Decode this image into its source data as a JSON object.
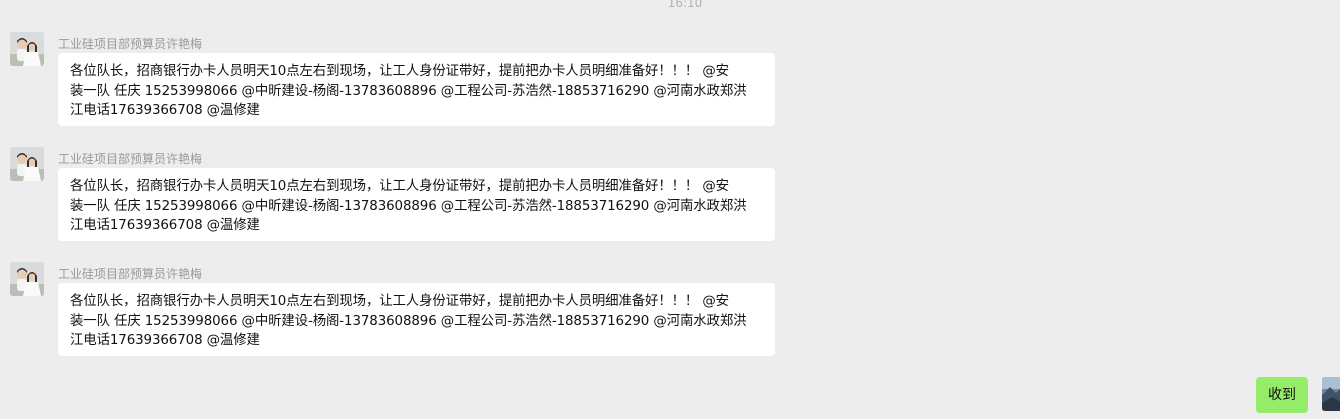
{
  "chat": {
    "timestamp": "16:10",
    "messages": [
      {
        "sender": "工业硅项目部预算员许艳梅",
        "avatar_icon": "couple-photo-avatar-icon",
        "lines": [
          "各位队长，招商银行办卡人员明天10点左右到现场，让工人身份证带好，提前把办卡人员明细准备好！！！ @安",
          "装一队 任庆 15253998066 @中昕建设-杨阁-13783608896 @工程公司-苏浩然-18853716290 @河南水政郑洪",
          "江电话17639366708 @温修建"
        ]
      },
      {
        "sender": "工业硅项目部预算员许艳梅",
        "avatar_icon": "couple-photo-avatar-icon",
        "lines": [
          "各位队长，招商银行办卡人员明天10点左右到现场，让工人身份证带好，提前把办卡人员明细准备好！！！ @安",
          "装一队 任庆 15253998066 @中昕建设-杨阁-13783608896 @工程公司-苏浩然-18853716290 @河南水政郑洪",
          "江电话17639366708 @温修建"
        ]
      },
      {
        "sender": "工业硅项目部预算员许艳梅",
        "avatar_icon": "couple-photo-avatar-icon",
        "lines": [
          "各位队长，招商银行办卡人员明天10点左右到现场，让工人身份证带好，提前把办卡人员明细准备好！！！ @安",
          "装一队 任庆 15253998066 @中昕建设-杨阁-13783608896 @工程公司-苏浩然-18853716290 @河南水政郑洪",
          "江电话17639366708 @温修建"
        ]
      }
    ],
    "self_message": {
      "text": "收到",
      "avatar_icon": "landscape-photo-avatar-icon",
      "bubble_color": "#95ec69"
    },
    "colors": {
      "background": "#ededed",
      "bubble": "#ffffff",
      "sender": "#999999"
    }
  }
}
